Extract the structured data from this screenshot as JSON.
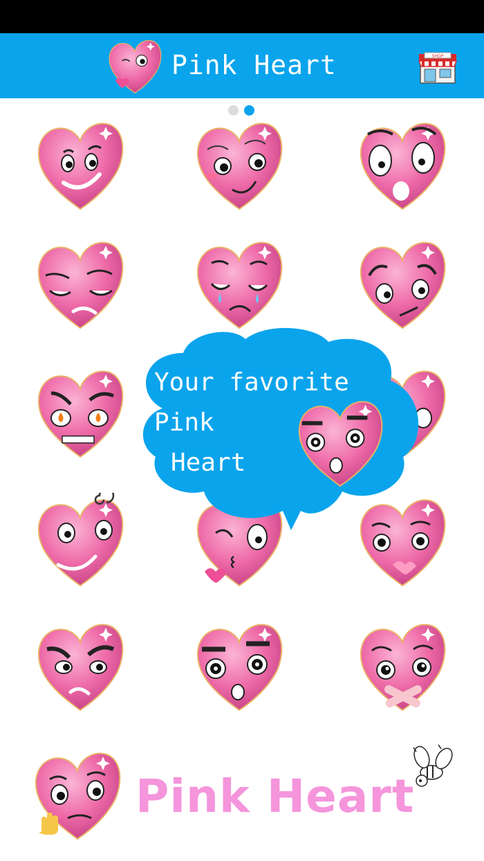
{
  "app": {
    "title": "Pink Heart"
  },
  "toolbar": {
    "shop_icon": "shop-store-icon",
    "shop_sign": "SHOP"
  },
  "pager": {
    "pages": 2,
    "current": 2
  },
  "colors": {
    "accent": "#0aa4ec",
    "heart": "#f06aa6",
    "logo_text": "#f595dc"
  },
  "stickers": [
    {
      "name": "smirk"
    },
    {
      "name": "shy"
    },
    {
      "name": "shocked"
    },
    {
      "name": "sleepy"
    },
    {
      "name": "crying"
    },
    {
      "name": "worried"
    },
    {
      "name": "angry-fire"
    },
    {
      "name": "hidden"
    },
    {
      "name": "hidden"
    },
    {
      "name": "dizzy"
    },
    {
      "name": "wink-kiss"
    },
    {
      "name": "kiss"
    },
    {
      "name": "grumpy"
    },
    {
      "name": "surprised"
    },
    {
      "name": "taped"
    }
  ],
  "bubble": {
    "line1": "Your favorite",
    "line2": "Pink",
    "line3": "Heart"
  },
  "footer": {
    "logo_text": "Pink Heart"
  }
}
